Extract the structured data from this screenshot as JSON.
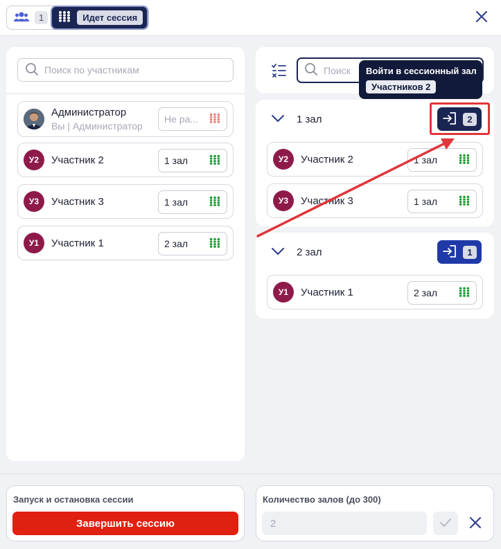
{
  "header": {
    "participants_count": "1",
    "session_status": "Идет сессия",
    "icons": {
      "participants": "people-group-icon",
      "session": "session-groups-icon",
      "close": "close-icon"
    }
  },
  "left": {
    "search_placeholder": "Поиск по участникам",
    "participants": [
      {
        "avatar": "photo",
        "name": "Администратор",
        "subtitle": "Вы | Администратор",
        "room": "Не распределен",
        "room_display": "Не ра...",
        "room_icon_color": "#e8837c"
      },
      {
        "avatar": "У2",
        "name": "Участник 2",
        "room": "1 зал",
        "room_icon_color": "#1f9b35"
      },
      {
        "avatar": "У3",
        "name": "Участник 3",
        "room": "1 зал",
        "room_icon_color": "#1f9b35"
      },
      {
        "avatar": "У1",
        "name": "Участник 1",
        "room": "2 зал",
        "room_icon_color": "#1f9b35"
      }
    ]
  },
  "right": {
    "search_placeholder": "Поиск",
    "halls": [
      {
        "title": "1 зал",
        "enter_count": "2",
        "members": [
          {
            "avatar": "У2",
            "name": "Участник 2",
            "room": "1 зал"
          },
          {
            "avatar": "У3",
            "name": "Участник 3",
            "room": "1 зал"
          }
        ]
      },
      {
        "title": "2 зал",
        "enter_count": "1",
        "members": [
          {
            "avatar": "У1",
            "name": "Участник 1",
            "room": "2 зал"
          }
        ]
      }
    ]
  },
  "tooltip": {
    "title": "Войти в сессионный зал",
    "subtitle": "Участников 2"
  },
  "bottom": {
    "session_control_label": "Запуск и остановка сессии",
    "end_session_label": "Завершить сессию",
    "hall_count_label": "Количество залов (до 300)",
    "hall_count_value": "2"
  },
  "colors": {
    "navy": "#1a2553",
    "blue_button": "#1f3aa8",
    "danger": "#e02010",
    "avatar_bg": "#8e1a4a",
    "room_green": "#1f9b35",
    "annotation_red": "#e0353a"
  }
}
